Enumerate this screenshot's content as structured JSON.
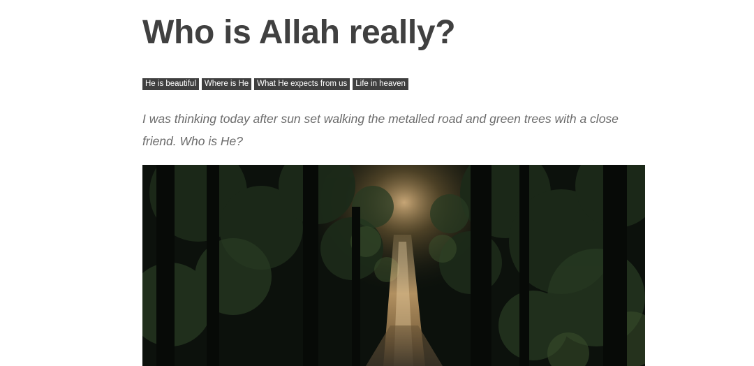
{
  "article": {
    "title": "Who is Allah really?",
    "tags": [
      "He is beautiful",
      "Where is He",
      "What He expects from us",
      "Life in heaven"
    ],
    "intro": "I was thinking today after sun set walking the metalled road and green trees with a close friend. Who is He?",
    "hero_image": {
      "subject": "forest-road-with-sunbeam",
      "colors": {
        "dark": "#0c110c",
        "foliage": "#1f2c1c",
        "light": "#d9b27a"
      }
    }
  }
}
